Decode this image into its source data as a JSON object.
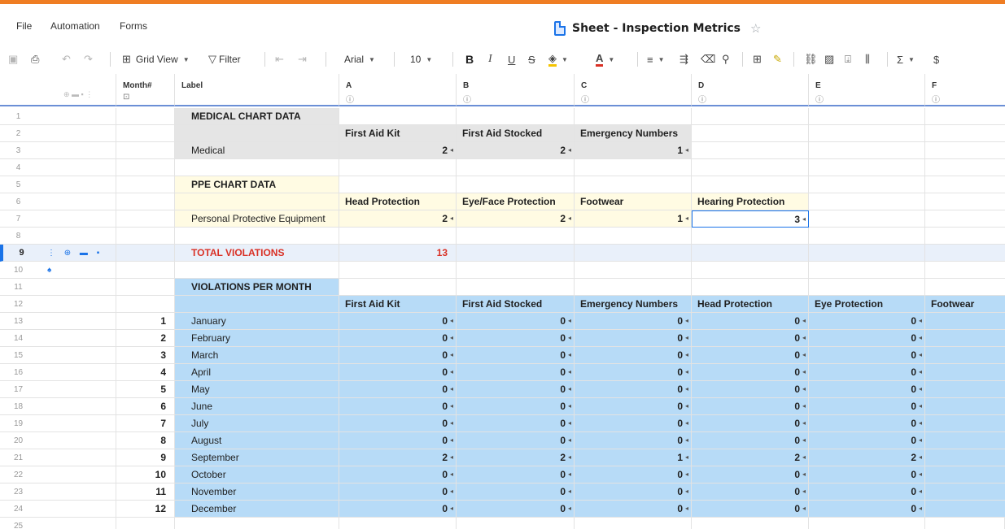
{
  "menu": {
    "file": "File",
    "automation": "Automation",
    "forms": "Forms"
  },
  "title": "Sheet - Inspection Metrics",
  "toolbar": {
    "grid_view": "Grid View",
    "filter": "Filter",
    "font": "Arial",
    "font_size": "10"
  },
  "columns": {
    "month": "Month#",
    "label": "Label",
    "a": "A",
    "b": "B",
    "c": "C",
    "d": "D",
    "e": "E",
    "f": "F"
  },
  "rows": [
    {
      "n": "1",
      "label": "MEDICAL CHART DATA",
      "cells": [
        "",
        "",
        "",
        "",
        "",
        ""
      ]
    },
    {
      "n": "2",
      "label": "",
      "cells": [
        "First Aid Kit",
        "First Aid Stocked",
        "Emergency Numbers",
        "",
        "",
        ""
      ]
    },
    {
      "n": "3",
      "label": "Medical",
      "cells": [
        "2",
        "2",
        "1",
        "",
        "",
        ""
      ]
    },
    {
      "n": "4",
      "label": "",
      "cells": [
        "",
        "",
        "",
        "",
        "",
        ""
      ]
    },
    {
      "n": "5",
      "label": "PPE CHART DATA",
      "cells": [
        "",
        "",
        "",
        "",
        "",
        ""
      ]
    },
    {
      "n": "6",
      "label": "",
      "cells": [
        "Head Protection",
        "Eye/Face Protection",
        "Footwear",
        "Hearing Protection",
        "",
        ""
      ]
    },
    {
      "n": "7",
      "label": "Personal Protective Equipment",
      "cells": [
        "2",
        "2",
        "1",
        "3",
        "",
        ""
      ]
    },
    {
      "n": "8",
      "label": "",
      "cells": [
        "",
        "",
        "",
        "",
        "",
        ""
      ]
    },
    {
      "n": "9",
      "label": "TOTAL VIOLATIONS",
      "cells": [
        "13",
        "",
        "",
        "",
        "",
        ""
      ]
    },
    {
      "n": "10",
      "label": "",
      "cells": [
        "",
        "",
        "",
        "",
        "",
        ""
      ]
    },
    {
      "n": "11",
      "label": "VIOLATIONS PER MONTH",
      "cells": [
        "",
        "",
        "",
        "",
        "",
        ""
      ]
    },
    {
      "n": "12",
      "label": "",
      "cells": [
        "First Aid Kit",
        "First Aid Stocked",
        "Emergency Numbers",
        "Head Protection",
        "Eye Protection",
        "Footwear"
      ]
    }
  ],
  "months": [
    {
      "n": "13",
      "m": "1",
      "label": "January",
      "cells": [
        "0",
        "0",
        "0",
        "0",
        "0"
      ]
    },
    {
      "n": "14",
      "m": "2",
      "label": "February",
      "cells": [
        "0",
        "0",
        "0",
        "0",
        "0"
      ]
    },
    {
      "n": "15",
      "m": "3",
      "label": "March",
      "cells": [
        "0",
        "0",
        "0",
        "0",
        "0"
      ]
    },
    {
      "n": "16",
      "m": "4",
      "label": "April",
      "cells": [
        "0",
        "0",
        "0",
        "0",
        "0"
      ]
    },
    {
      "n": "17",
      "m": "5",
      "label": "May",
      "cells": [
        "0",
        "0",
        "0",
        "0",
        "0"
      ]
    },
    {
      "n": "18",
      "m": "6",
      "label": "June",
      "cells": [
        "0",
        "0",
        "0",
        "0",
        "0"
      ]
    },
    {
      "n": "19",
      "m": "7",
      "label": "July",
      "cells": [
        "0",
        "0",
        "0",
        "0",
        "0"
      ]
    },
    {
      "n": "20",
      "m": "8",
      "label": "August",
      "cells": [
        "0",
        "0",
        "0",
        "0",
        "0"
      ]
    },
    {
      "n": "21",
      "m": "9",
      "label": "September",
      "cells": [
        "2",
        "2",
        "1",
        "2",
        "2"
      ]
    },
    {
      "n": "22",
      "m": "10",
      "label": "October",
      "cells": [
        "0",
        "0",
        "0",
        "0",
        "0"
      ]
    },
    {
      "n": "23",
      "m": "11",
      "label": "November",
      "cells": [
        "0",
        "0",
        "0",
        "0",
        "0"
      ]
    },
    {
      "n": "24",
      "m": "12",
      "label": "December",
      "cells": [
        "0",
        "0",
        "0",
        "0",
        "0"
      ]
    }
  ],
  "last_row": "25",
  "colors": {
    "accent": "#ef7d23",
    "total": "#d93025",
    "blue_fill": "#b7dbf7",
    "yellow_fill": "#fffbe3",
    "gray_fill": "#e5e5e5"
  }
}
